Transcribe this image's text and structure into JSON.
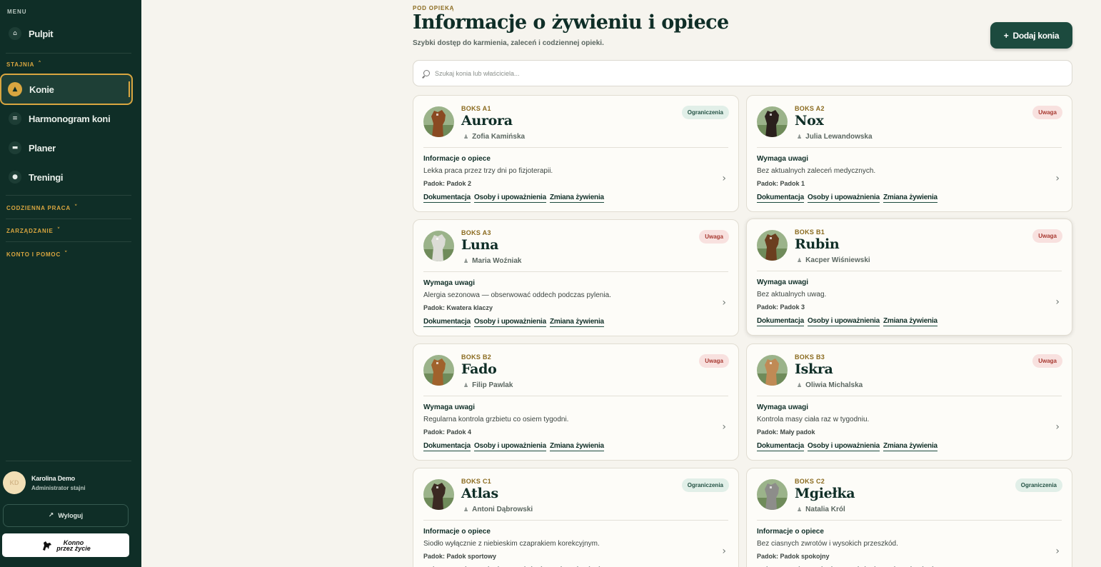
{
  "sidebar": {
    "menu_label": "MENU",
    "dashboard": {
      "label": "Pulpit",
      "icon": "home-icon"
    },
    "stable_section": "STAJNIA",
    "items": [
      {
        "label": "Konie",
        "icon": "horse-icon",
        "active": true
      },
      {
        "label": "Harmonogram koni",
        "icon": "list-icon"
      },
      {
        "label": "Planer",
        "icon": "calendar-icon"
      },
      {
        "label": "Treningi",
        "icon": "training-icon"
      }
    ],
    "sections": [
      "CODZIENNA PRACA",
      "ZARZĄDZANIE",
      "KONTO I POMOC"
    ],
    "user": {
      "initials": "KD",
      "name": "Karolina Demo",
      "role": "Administrator stajni"
    },
    "logout_label": "Wyloguj",
    "brand": {
      "line1": "Konno",
      "line2": "przez życie"
    }
  },
  "header": {
    "kicker": "POD OPIEKĄ",
    "title": "Informacje o żywieniu i opiece",
    "subtitle": "Szybki dostęp do karmienia, zaleceń i codziennej opieki.",
    "add_button": "Dodaj konia"
  },
  "search": {
    "placeholder": "Szukaj konia lub właściciela..."
  },
  "link_labels": [
    "Dokumentacja",
    "Osoby i upoważnienia",
    "Zmiana żywienia"
  ],
  "horses": [
    {
      "box": "BOKS A1",
      "name": "Aurora",
      "owner": "Zofia Kamińska",
      "badge": "Ograniczenia",
      "badge_type": "limit",
      "care_title": "Informacje o opiece",
      "care_text": "Lekka praca przez trzy dni po fizjoterapii.",
      "paddock": "Padok: Padok 2",
      "color": "#8a4a22"
    },
    {
      "box": "BOKS A2",
      "name": "Nox",
      "owner": "Julia Lewandowska",
      "badge": "Uwaga",
      "badge_type": "warn",
      "care_title": "Wymaga uwagi",
      "care_text": "Bez aktualnych zaleceń medycznych.",
      "paddock": "Padok: Padok 1",
      "color": "#2a201c"
    },
    {
      "box": "BOKS A3",
      "name": "Luna",
      "owner": "Maria Woźniak",
      "badge": "Uwaga",
      "badge_type": "warn",
      "care_title": "Wymaga uwagi",
      "care_text": "Alergia sezonowa — obserwować oddech podczas pylenia.",
      "paddock": "Padok: Kwatera klaczy",
      "color": "#dcdcd6"
    },
    {
      "box": "BOKS B1",
      "name": "Rubin",
      "owner": "Kacper Wiśniewski",
      "badge": "Uwaga",
      "badge_type": "warn",
      "care_title": "Wymaga uwagi",
      "care_text": "Bez aktualnych uwag.",
      "paddock": "Padok: Padok 3",
      "color": "#6b3e1f"
    },
    {
      "box": "BOKS B2",
      "name": "Fado",
      "owner": "Filip Pawlak",
      "badge": "Uwaga",
      "badge_type": "warn",
      "care_title": "Wymaga uwagi",
      "care_text": "Regularna kontrola grzbietu co osiem tygodni.",
      "paddock": "Padok: Padok 4",
      "color": "#a0622c"
    },
    {
      "box": "BOKS B3",
      "name": "Iskra",
      "owner": "Oliwia Michalska",
      "badge": "Uwaga",
      "badge_type": "warn",
      "care_title": "Wymaga uwagi",
      "care_text": "Kontrola masy ciała raz w tygodniu.",
      "paddock": "Padok: Mały padok",
      "color": "#c08a55"
    },
    {
      "box": "BOKS C1",
      "name": "Atlas",
      "owner": "Antoni Dąbrowski",
      "badge": "Ograniczenia",
      "badge_type": "limit",
      "care_title": "Informacje o opiece",
      "care_text": "Siodło wyłącznie z niebieskim czaprakiem korekcyjnym.",
      "paddock": "Padok: Padok sportowy",
      "color": "#3b2a22"
    },
    {
      "box": "BOKS C2",
      "name": "Mgiełka",
      "owner": "Natalia Król",
      "badge": "Ograniczenia",
      "badge_type": "limit",
      "care_title": "Informacje o opiece",
      "care_text": "Bez ciasnych zwrotów i wysokich przeszkód.",
      "paddock": "Padok: Padok spokojny",
      "color": "#8d8d8a"
    }
  ]
}
